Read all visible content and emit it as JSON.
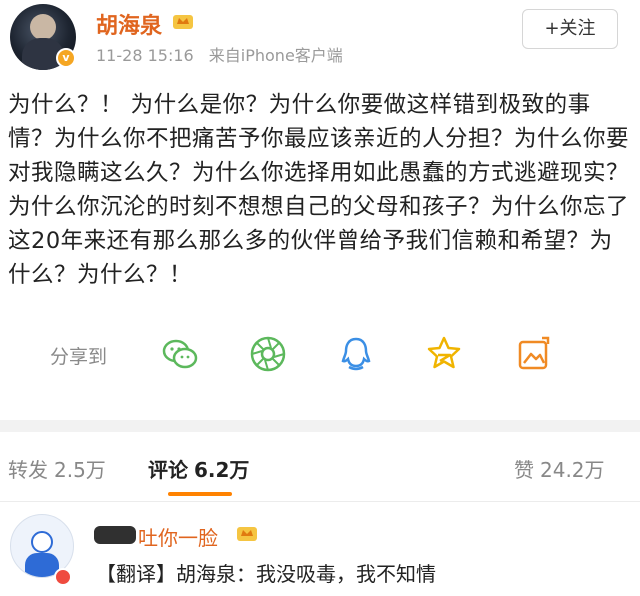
{
  "post": {
    "author": "胡海泉",
    "time": "11-28 15:16",
    "source": "来自iPhone客户端",
    "follow_label": "+关注",
    "text": "为什么？！ 为什么是你？为什么你要做这样错到极致的事情？为什么你不把痛苦予你最应该亲近的人分担？为什么你要对我隐瞒这么久？为什么你选择用如此愚蠢的方式逃避现实？为什么你沉沦的时刻不想想自己的父母和孩子？为什么你忘了这20年来还有那么那么多的伙伴曾给予我们信赖和希望？为什么？为什么？！"
  },
  "share": {
    "label": "分享到",
    "icons": [
      "wechat-icon",
      "moments-icon",
      "qq-icon",
      "qzone-icon",
      "image-share-icon"
    ]
  },
  "stats": {
    "repost_label": "转发",
    "repost_count": "2.5万",
    "comment_label": "评论",
    "comment_count": "6.2万",
    "like_label": "赞",
    "like_count": "24.2万"
  },
  "comment": {
    "name": "吐你一脸",
    "text": "【翻译】胡海泉：我没吸毒，我不知情"
  },
  "colors": {
    "username": "#e0651f",
    "accent": "#ff8200",
    "icon_green": "#5cb85c",
    "icon_blue": "#3b8fe5",
    "icon_yellow": "#f0b400",
    "icon_orange": "#f08a24"
  }
}
